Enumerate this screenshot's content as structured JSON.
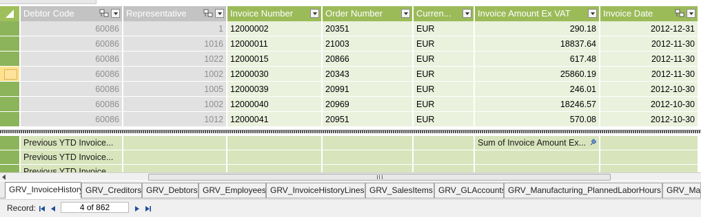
{
  "columns": [
    {
      "label": "Debtor Code",
      "dimmed": true,
      "filter_icon": true
    },
    {
      "label": "Representative",
      "dimmed": true,
      "filter_icon": true
    },
    {
      "label": "Invoice Number",
      "dimmed": false,
      "filter_icon": false
    },
    {
      "label": "Order Number",
      "dimmed": false,
      "filter_icon": false
    },
    {
      "label": "Curren...",
      "dimmed": false,
      "filter_icon": false
    },
    {
      "label": "Invoice Amount Ex VAT",
      "dimmed": false,
      "filter_icon": false
    },
    {
      "label": "Invoice Date",
      "dimmed": false,
      "filter_icon": true
    }
  ],
  "rows": [
    [
      "60086",
      "1",
      "12000002",
      "20351",
      "EUR",
      "290.18",
      "2012-12-31"
    ],
    [
      "60086",
      "1016",
      "12000011",
      "21003",
      "EUR",
      "18837.64",
      "2012-11-30"
    ],
    [
      "60086",
      "1022",
      "12000015",
      "20866",
      "EUR",
      "617.48",
      "2012-11-30"
    ],
    [
      "60086",
      "1002",
      "12000030",
      "20343",
      "EUR",
      "25860.19",
      "2012-11-30"
    ],
    [
      "60086",
      "1005",
      "12000039",
      "20991",
      "EUR",
      "246.01",
      "2012-10-30"
    ],
    [
      "60086",
      "1002",
      "12000040",
      "20969",
      "EUR",
      "18246.57",
      "2012-10-30"
    ],
    [
      "60086",
      "1012",
      "12000041",
      "20951",
      "EUR",
      "570.08",
      "2012-10-30"
    ]
  ],
  "current_row_index": 3,
  "footer": {
    "row1_label": "Previous YTD Invoice...",
    "row1_sum_label": "Sum of Invoice Amount Ex...",
    "row2_label": "Previous YTD Invoice...",
    "row3_label": "Previous YTD Invoice..."
  },
  "tabs": [
    "GRV_InvoiceHistory",
    "GRV_Creditors",
    "GRV_Debtors",
    "GRV_Employees",
    "GRV_InvoiceHistoryLines",
    "GRV_SalesItems",
    "GRV_GLAccounts",
    "GRV_Manufacturing_PlannedLaborHours",
    "GRV_Man"
  ],
  "active_tab_index": 0,
  "status": {
    "record_label": "Record:",
    "record_position": "4 of 862"
  },
  "colors": {
    "header_green": "#9bbb59",
    "header_dimmed": "#c3c3c3",
    "cell_green": "#eaf1dd",
    "footer_green": "#d8e4bc",
    "current_row": "#ffe08c"
  }
}
